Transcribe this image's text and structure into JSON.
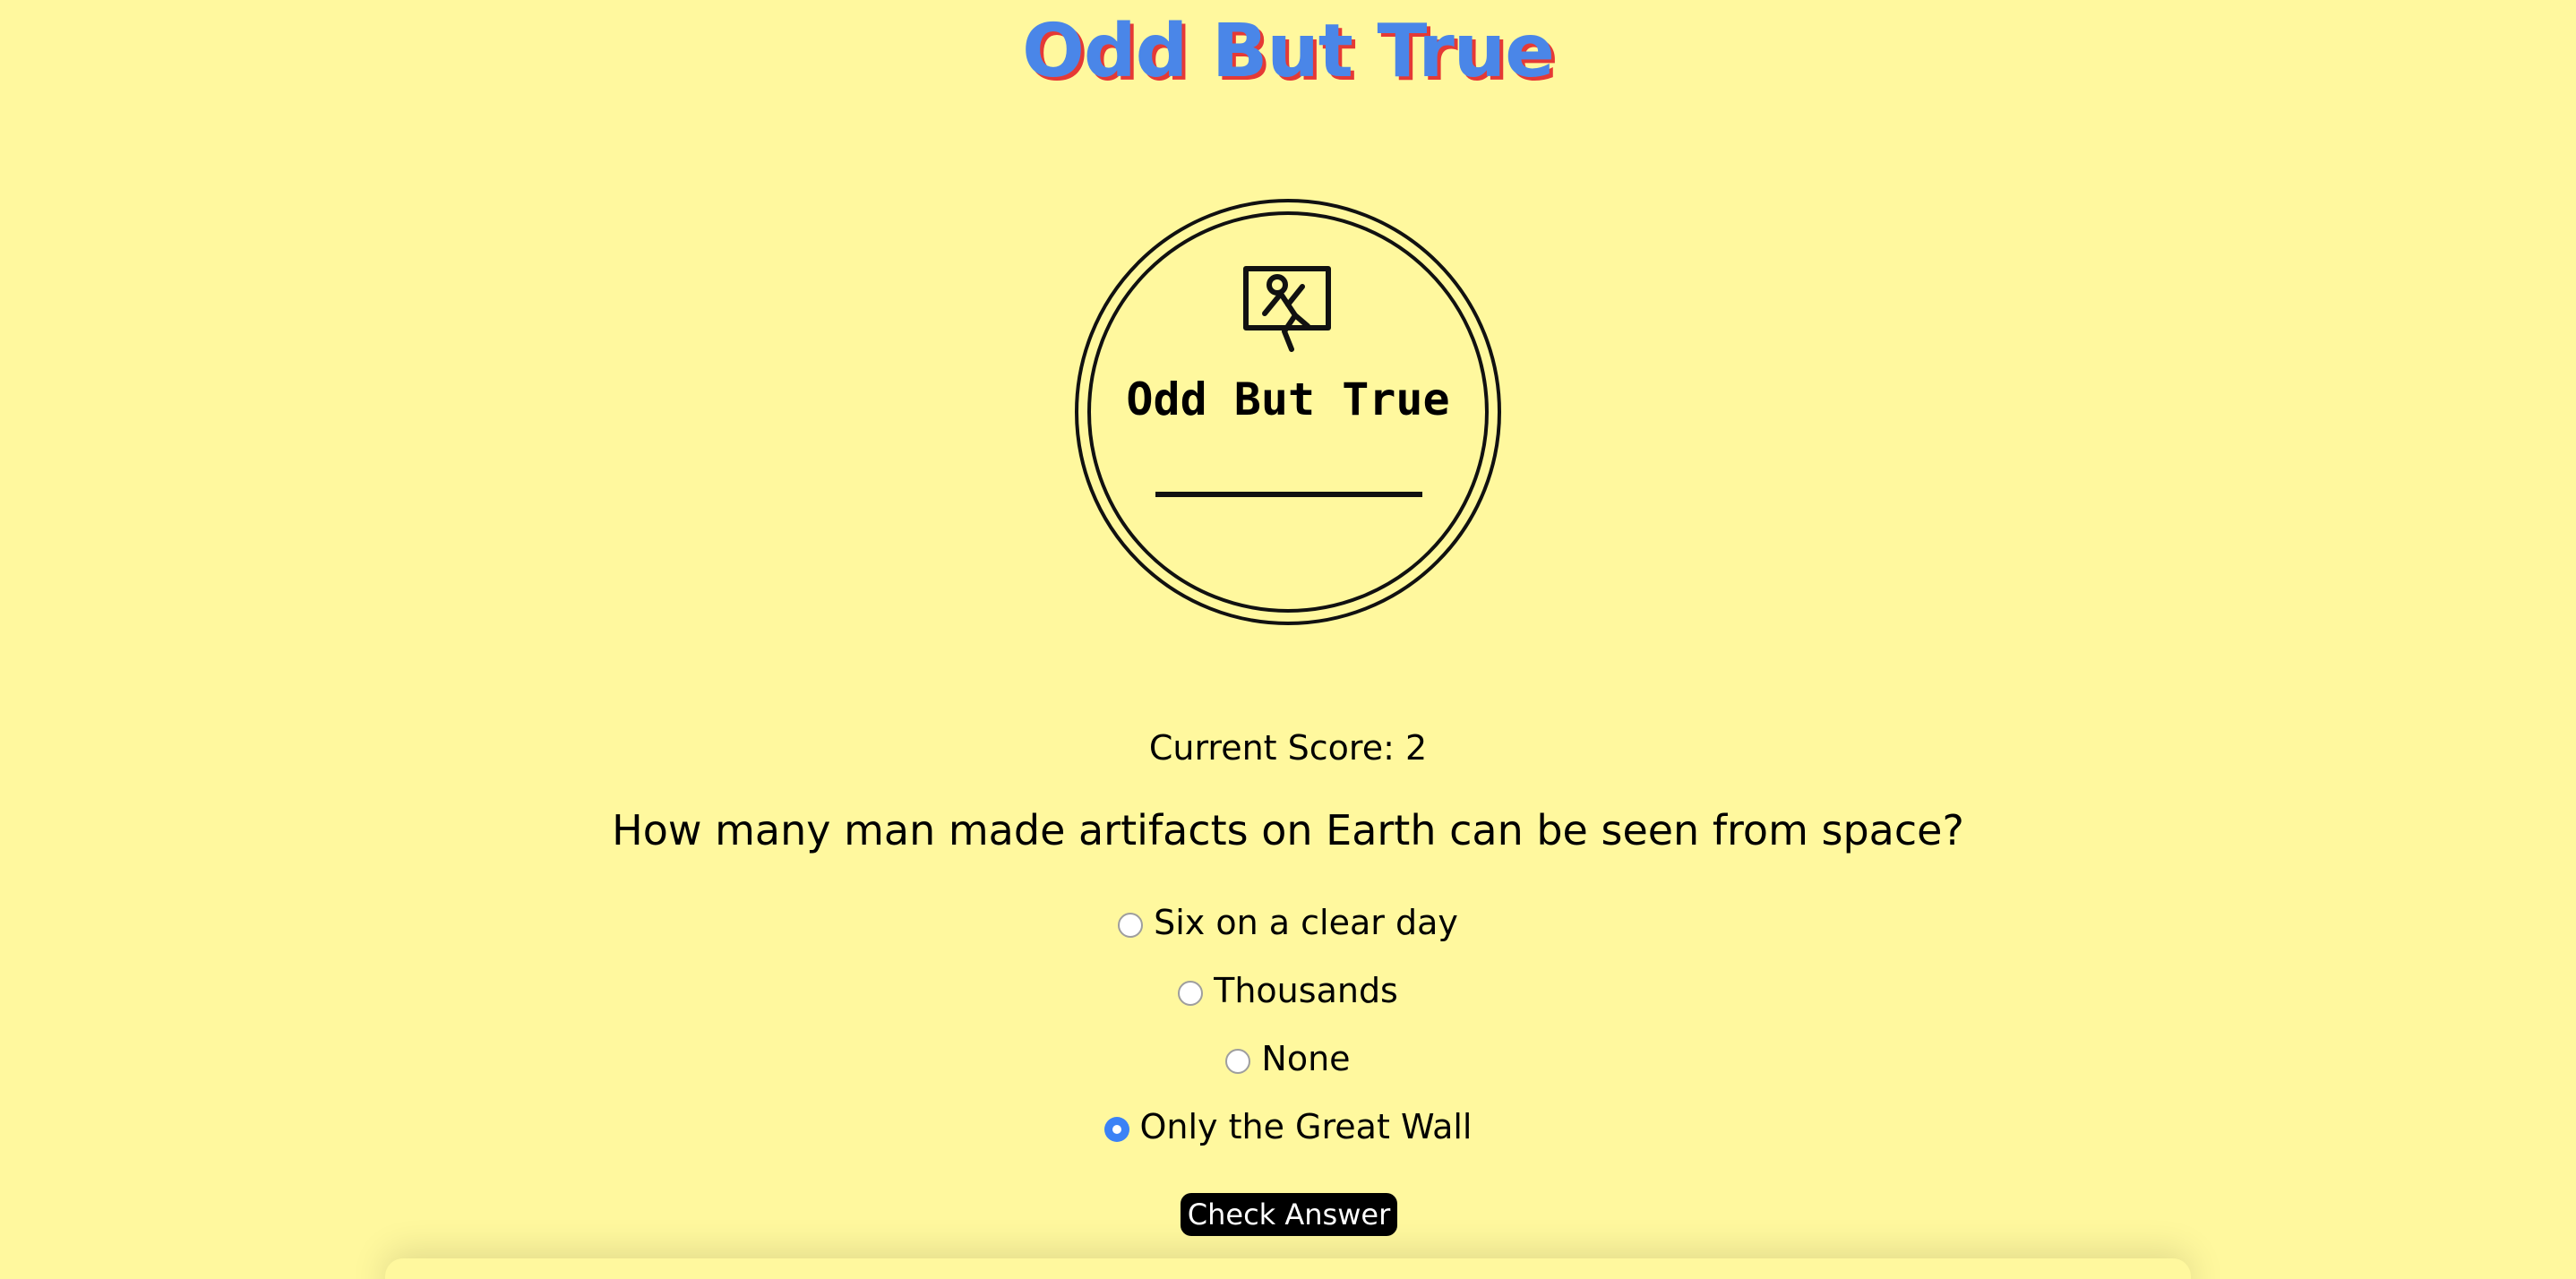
{
  "header": {
    "title": "Odd But True"
  },
  "logo": {
    "text": "Odd But True",
    "icon": "person-window-icon"
  },
  "quiz": {
    "score_text": "Current Score: 2",
    "question": "How many man made artifacts on Earth can be seen from space?",
    "options": [
      {
        "label": "Six on a clear day",
        "checked": false
      },
      {
        "label": "Thousands",
        "checked": false
      },
      {
        "label": "None",
        "checked": false
      },
      {
        "label": "Only the Great Wall",
        "checked": true
      }
    ],
    "check_button": "Check Answer"
  },
  "colors": {
    "background": "#fff89e",
    "title": "#4a86e8",
    "title_shadow": "#e53935",
    "radio_checked": "#3b82f6",
    "button": "#000000"
  }
}
